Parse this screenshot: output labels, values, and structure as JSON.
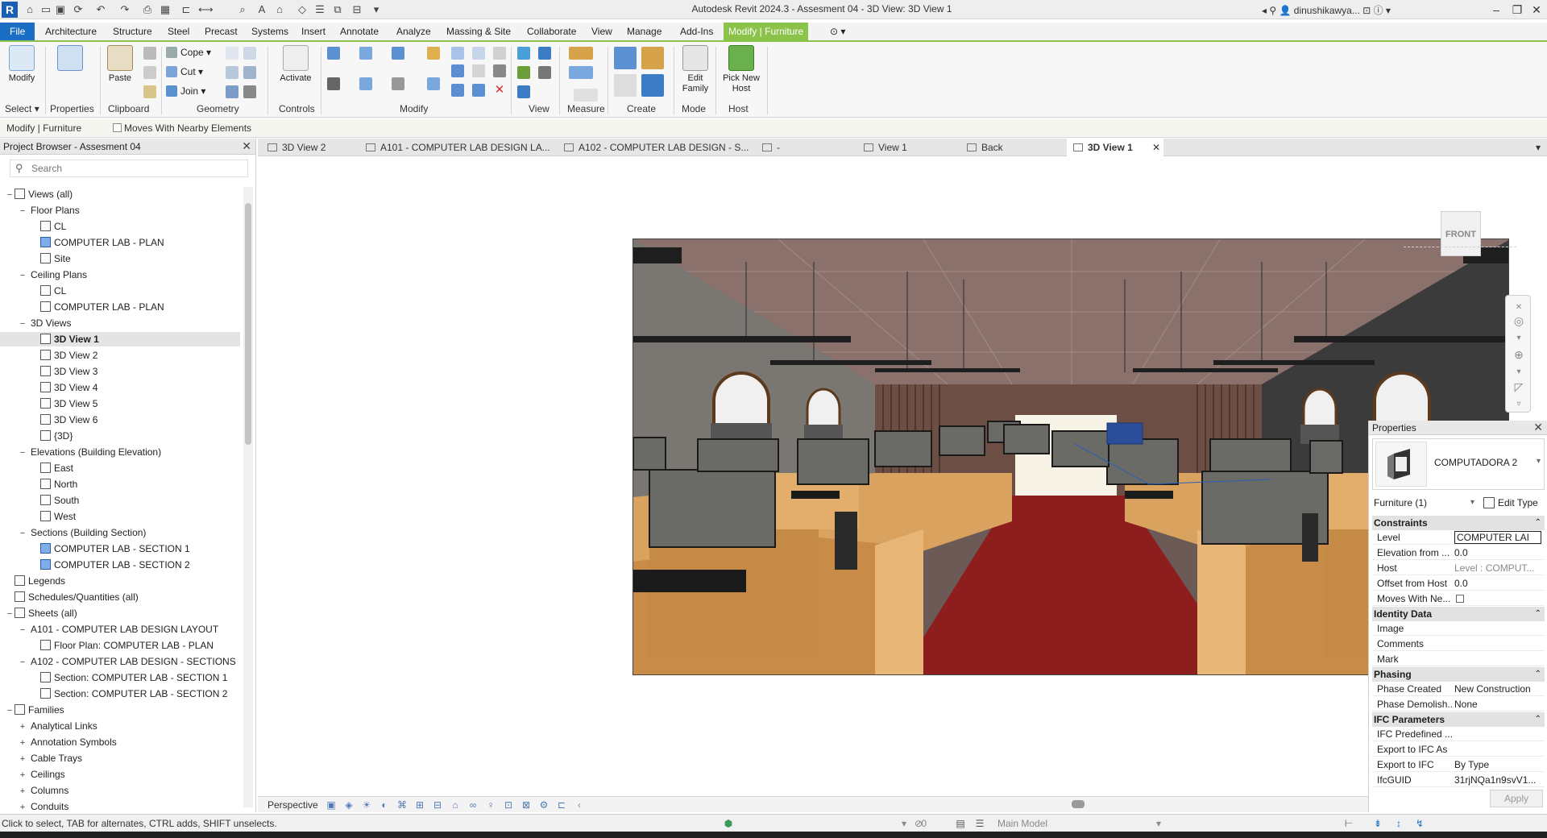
{
  "titlebar": {
    "title": "Autodesk Revit 2024.3 - Assesment 04 - 3D View: 3D View 1",
    "user": "dinushikawya...",
    "logo": "R"
  },
  "ribbon": {
    "tabs": [
      "File",
      "Architecture",
      "Structure",
      "Steel",
      "Precast",
      "Systems",
      "Insert",
      "Annotate",
      "Analyze",
      "Massing & Site",
      "Collaborate",
      "View",
      "Manage",
      "Add-Ins",
      "Modify | Furniture"
    ],
    "active_tab": "Modify | Furniture",
    "panels": {
      "select": "Select",
      "properties": "Properties",
      "clipboard": "Clipboard",
      "geometry": "Geometry",
      "controls": "Controls",
      "modify": "Modify",
      "view": "View",
      "measure": "Measure",
      "create": "Create",
      "mode": "Mode",
      "host": "Host"
    },
    "buttons": {
      "modify": "Modify",
      "paste": "Paste",
      "cope": "Cope",
      "cut": "Cut",
      "join": "Join",
      "activate": "Activate",
      "edit_family": "Edit Family",
      "pick_new_host": "Pick New Host"
    }
  },
  "context_bar": {
    "label": "Modify | Furniture",
    "checkbox_label": "Moves With Nearby Elements"
  },
  "project_browser": {
    "title": "Project Browser - Assesment 04",
    "search_placeholder": "Search",
    "tree": [
      {
        "label": "Views (all)",
        "level": 0,
        "toggle": "−",
        "icon": "views"
      },
      {
        "label": "Floor Plans",
        "level": 1,
        "toggle": "−"
      },
      {
        "label": "CL",
        "level": 2,
        "icon": "view"
      },
      {
        "label": "COMPUTER LAB - PLAN",
        "level": 2,
        "icon": "view-blue"
      },
      {
        "label": "Site",
        "level": 2,
        "icon": "view"
      },
      {
        "label": "Ceiling Plans",
        "level": 1,
        "toggle": "−"
      },
      {
        "label": "CL",
        "level": 2,
        "icon": "view"
      },
      {
        "label": "COMPUTER LAB - PLAN",
        "level": 2,
        "icon": "view"
      },
      {
        "label": "3D Views",
        "level": 1,
        "toggle": "−"
      },
      {
        "label": "3D View 1",
        "level": 2,
        "icon": "view",
        "selected": true
      },
      {
        "label": "3D View 2",
        "level": 2,
        "icon": "view"
      },
      {
        "label": "3D View 3",
        "level": 2,
        "icon": "view"
      },
      {
        "label": "3D View 4",
        "level": 2,
        "icon": "view"
      },
      {
        "label": "3D View 5",
        "level": 2,
        "icon": "view"
      },
      {
        "label": "3D View 6",
        "level": 2,
        "icon": "view"
      },
      {
        "label": "{3D}",
        "level": 2,
        "icon": "view"
      },
      {
        "label": "Elevations (Building Elevation)",
        "level": 1,
        "toggle": "−"
      },
      {
        "label": "East",
        "level": 2,
        "icon": "view"
      },
      {
        "label": "North",
        "level": 2,
        "icon": "view"
      },
      {
        "label": "South",
        "level": 2,
        "icon": "view"
      },
      {
        "label": "West",
        "level": 2,
        "icon": "view"
      },
      {
        "label": "Sections (Building Section)",
        "level": 1,
        "toggle": "−"
      },
      {
        "label": "COMPUTER LAB - SECTION 1",
        "level": 2,
        "icon": "view-blue"
      },
      {
        "label": "COMPUTER LAB - SECTION 2",
        "level": 2,
        "icon": "view-blue"
      },
      {
        "label": "Legends",
        "level": 0,
        "icon": "legend"
      },
      {
        "label": "Schedules/Quantities (all)",
        "level": 0,
        "icon": "schedule"
      },
      {
        "label": "Sheets (all)",
        "level": 0,
        "toggle": "−",
        "icon": "sheet"
      },
      {
        "label": "A101 - COMPUTER LAB DESIGN LAYOUT",
        "level": 1,
        "toggle": "−"
      },
      {
        "label": "Floor Plan: COMPUTER LAB - PLAN",
        "level": 2,
        "icon": "sheet"
      },
      {
        "label": "A102 - COMPUTER LAB DESIGN - SECTIONS",
        "level": 1,
        "toggle": "−"
      },
      {
        "label": "Section: COMPUTER LAB - SECTION 1",
        "level": 2,
        "icon": "section"
      },
      {
        "label": "Section: COMPUTER LAB - SECTION 2",
        "level": 2,
        "icon": "section"
      },
      {
        "label": "Families",
        "level": 0,
        "toggle": "−",
        "icon": "family"
      },
      {
        "label": "Analytical Links",
        "level": 1,
        "toggle": "+"
      },
      {
        "label": "Annotation Symbols",
        "level": 1,
        "toggle": "+"
      },
      {
        "label": "Cable Trays",
        "level": 1,
        "toggle": "+"
      },
      {
        "label": "Ceilings",
        "level": 1,
        "toggle": "+"
      },
      {
        "label": "Columns",
        "level": 1,
        "toggle": "+"
      },
      {
        "label": "Conduits",
        "level": 1,
        "toggle": "+"
      }
    ]
  },
  "view_tabs": [
    {
      "label": "3D View 2",
      "active": false
    },
    {
      "label": "A101 - COMPUTER LAB DESIGN LA...",
      "active": false
    },
    {
      "label": "A102 - COMPUTER LAB DESIGN - S...",
      "active": false
    },
    {
      "label": "-",
      "active": false
    },
    {
      "label": "View 1",
      "active": false
    },
    {
      "label": "Back",
      "active": false
    },
    {
      "label": "3D View 1",
      "active": true
    }
  ],
  "viewcube": {
    "face": "FRONT"
  },
  "view_control": {
    "label": "Perspective"
  },
  "properties": {
    "title": "Properties",
    "type_name": "COMPUTADORA 2",
    "filter": "Furniture (1)",
    "edit_type": "Edit Type",
    "groups": [
      {
        "name": "Constraints",
        "rows": [
          {
            "key": "Level",
            "value": "COMPUTER LAI",
            "style": "box"
          },
          {
            "key": "Elevation from ...",
            "value": "0.0"
          },
          {
            "key": "Host",
            "value": "Level : COMPUT...",
            "style": "grey"
          },
          {
            "key": "Offset from Host",
            "value": "0.0"
          },
          {
            "key": "Moves With Ne...",
            "value": "",
            "style": "checkbox"
          }
        ]
      },
      {
        "name": "Identity Data",
        "rows": [
          {
            "key": "Image",
            "value": ""
          },
          {
            "key": "Comments",
            "value": ""
          },
          {
            "key": "Mark",
            "value": ""
          }
        ]
      },
      {
        "name": "Phasing",
        "rows": [
          {
            "key": "Phase Created",
            "value": "New Construction"
          },
          {
            "key": "Phase Demolish...",
            "value": "None"
          }
        ]
      },
      {
        "name": "IFC Parameters",
        "rows": [
          {
            "key": "IFC Predefined ...",
            "value": ""
          },
          {
            "key": "Export to IFC As",
            "value": ""
          },
          {
            "key": "Export to IFC",
            "value": "By Type"
          },
          {
            "key": "IfcGUID",
            "value": "31rjNQa1n9svV1..."
          }
        ]
      }
    ],
    "apply": "Apply"
  },
  "statusbar": {
    "message": "Click to select, TAB for alternates, CTRL adds, SHIFT unselects.",
    "scale": ":0",
    "model": "Main Model"
  },
  "colors": {
    "accent_green": "#8bc34a",
    "file_blue": "#1a6fc4",
    "carpet_red": "#8e1d1d",
    "desk_wood": "#d9a25f",
    "monitor_grey": "#6a6a66"
  }
}
